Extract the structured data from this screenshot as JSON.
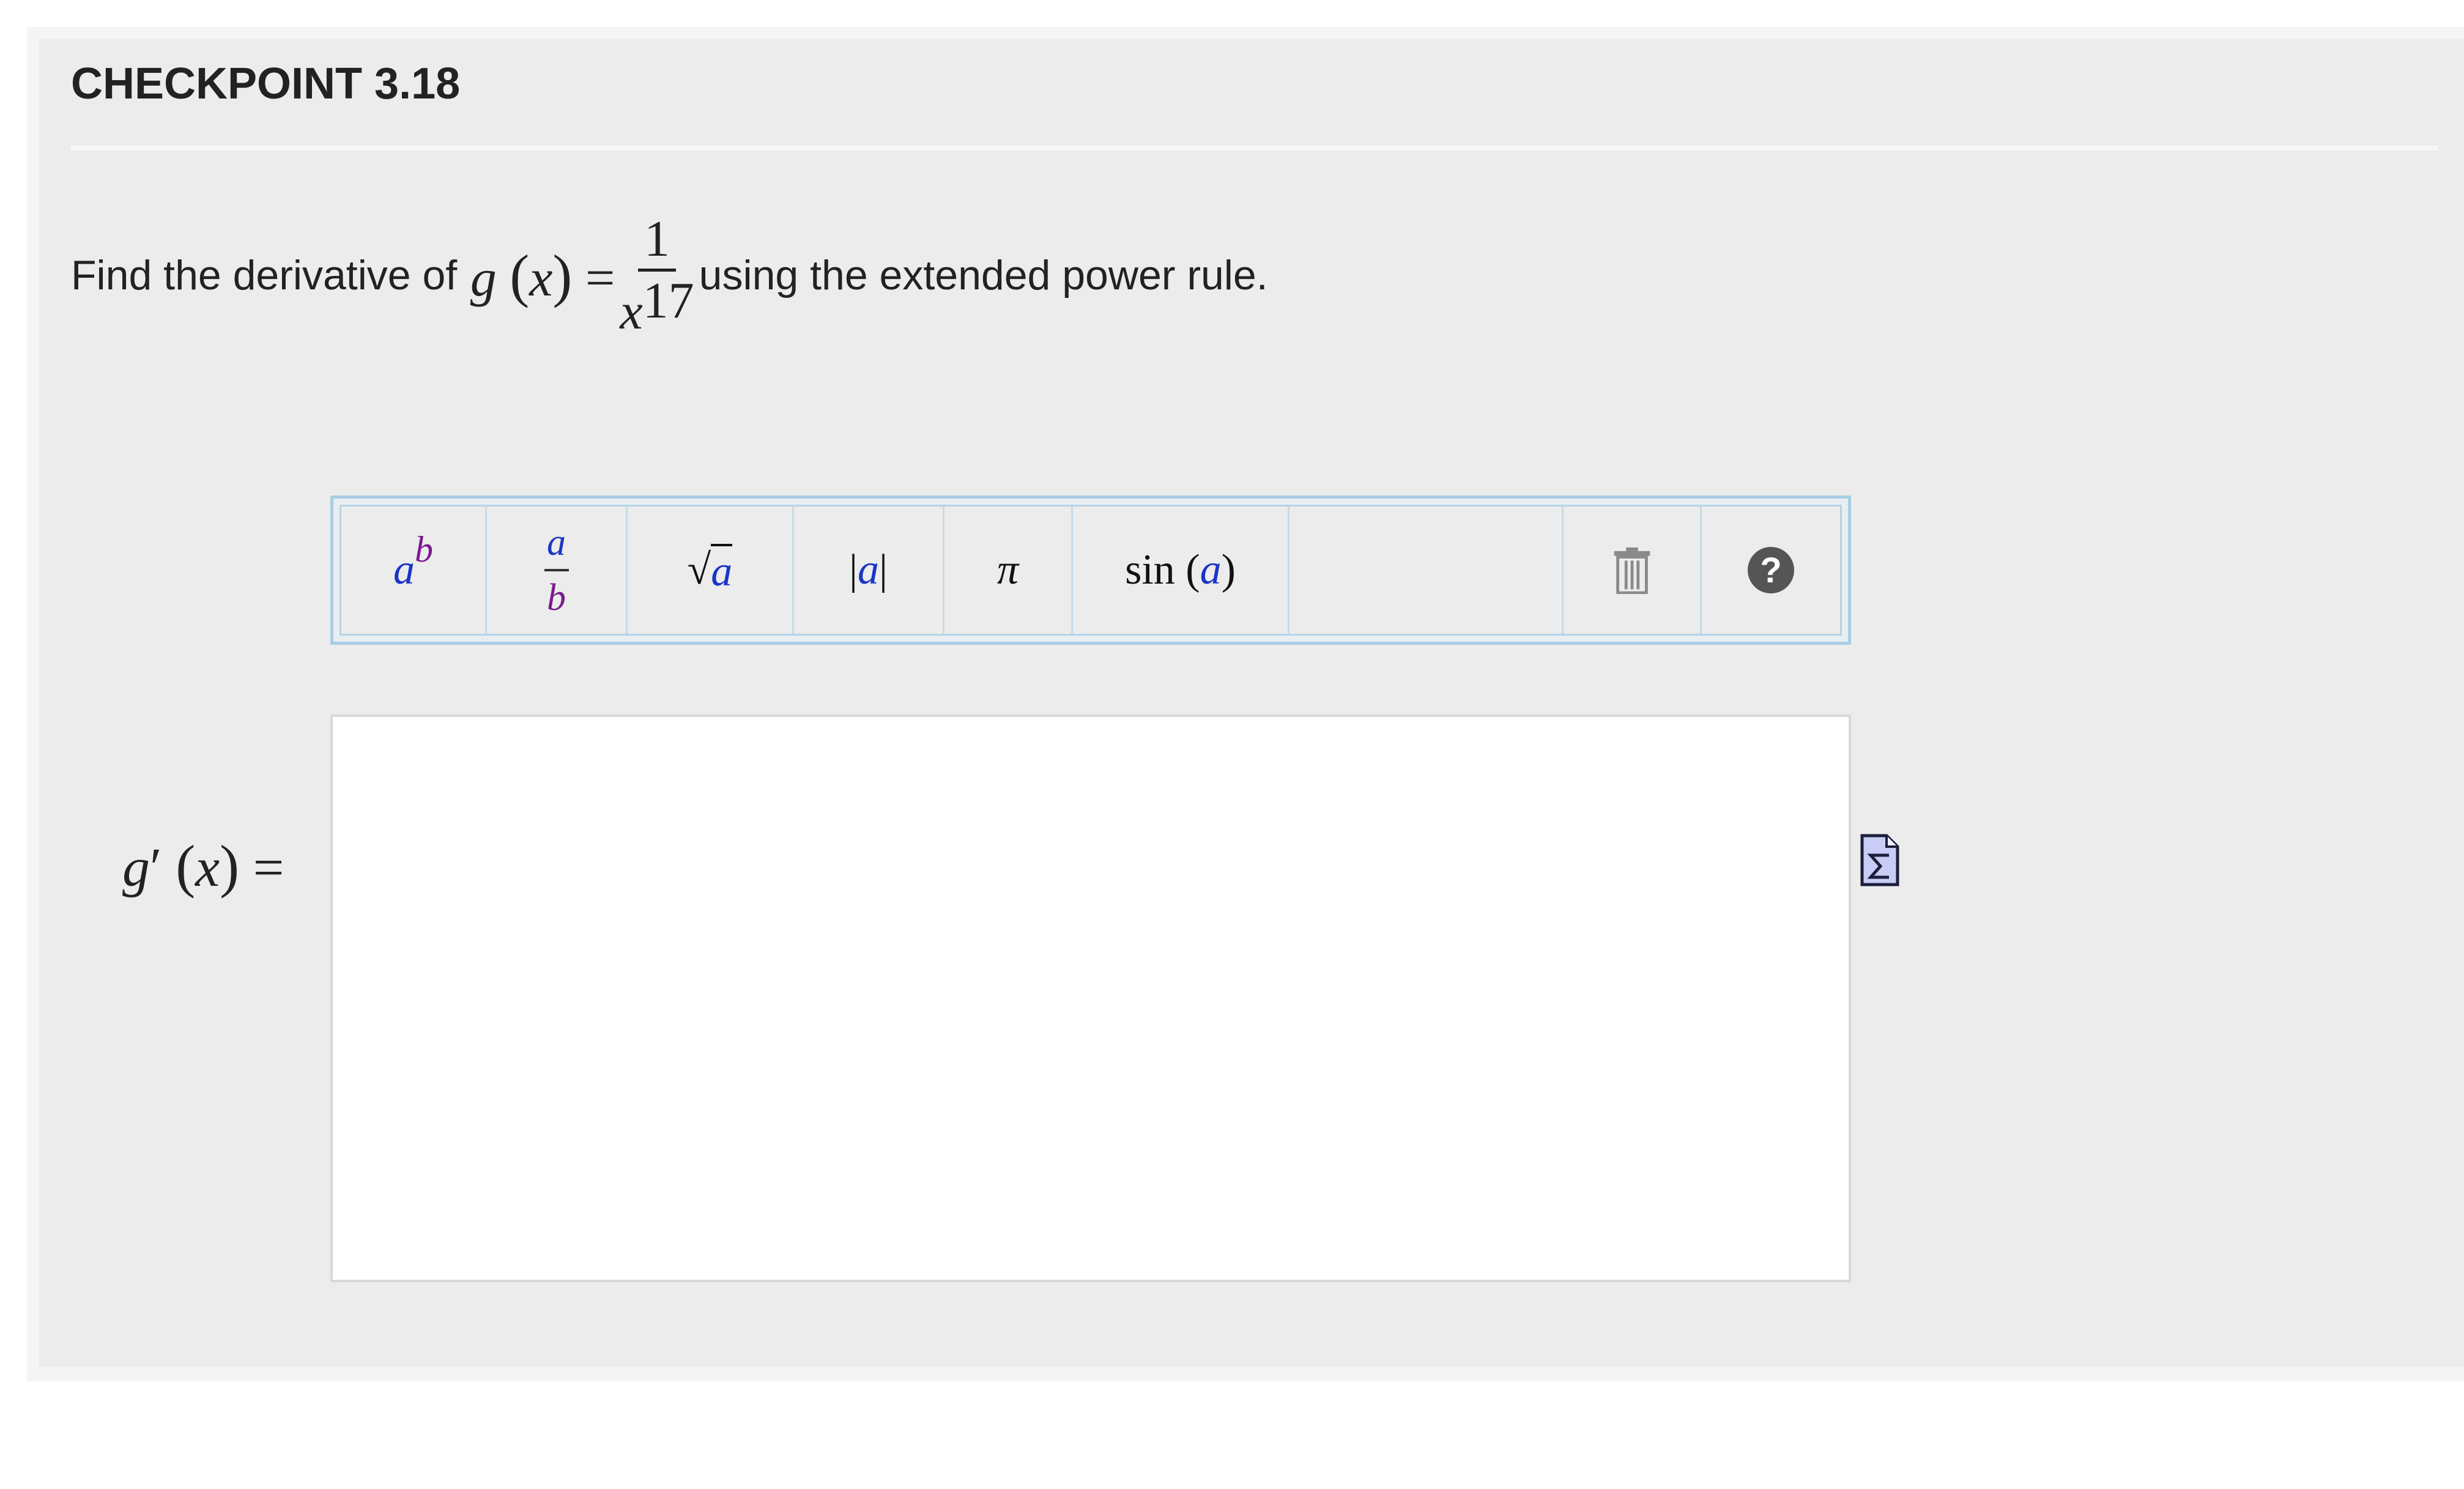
{
  "header": {
    "title": "CHECKPOINT 3.18"
  },
  "question": {
    "prefix": "Find the derivative of ",
    "func_name": "g",
    "var": "x",
    "equals": "=",
    "numerator": "1",
    "den_base": "x",
    "den_exp": "17",
    "suffix": "using the extended power rule."
  },
  "toolbar": {
    "buttons": [
      {
        "name": "exponent",
        "base": "a",
        "exp": "b"
      },
      {
        "name": "fraction",
        "num": "a",
        "den": "b"
      },
      {
        "name": "square-root",
        "root": "√",
        "arg": "a"
      },
      {
        "name": "absolute-value",
        "bar": "|",
        "arg": "a"
      },
      {
        "name": "pi",
        "symbol": "π"
      },
      {
        "name": "sine",
        "func": "sin",
        "arg": "a",
        "open": "(",
        "close": ")"
      }
    ],
    "trash_icon": "trash-icon",
    "help_icon": "question-circle-icon",
    "help_glyph": "?"
  },
  "answer": {
    "label_func": "g",
    "label_prime": "′",
    "label_var": "x",
    "label_equals": "=",
    "value": ""
  },
  "colors": {
    "panel": "#ececec",
    "toolbar_border": "#a9cde3",
    "var_blue": "#1a35c8",
    "var_purple": "#7a1c8e"
  }
}
